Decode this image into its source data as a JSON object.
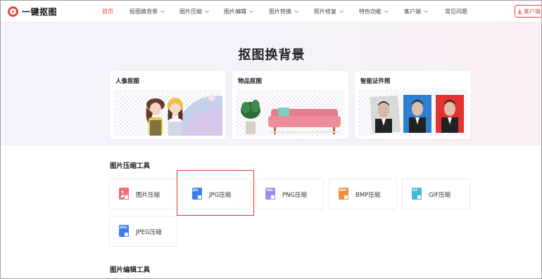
{
  "brand": {
    "name": "一键抠图",
    "color": "#e84a3c"
  },
  "nav": {
    "items": [
      {
        "label": "首页",
        "active": true,
        "dropdown": false
      },
      {
        "label": "抠图换背景",
        "active": false,
        "dropdown": true
      },
      {
        "label": "图片压缩",
        "active": false,
        "dropdown": true
      },
      {
        "label": "图片编辑",
        "active": false,
        "dropdown": true
      },
      {
        "label": "图片转换",
        "active": false,
        "dropdown": true
      },
      {
        "label": "照片修复",
        "active": false,
        "dropdown": true
      },
      {
        "label": "特色功能",
        "active": false,
        "dropdown": true
      },
      {
        "label": "客户端",
        "active": false,
        "dropdown": true
      },
      {
        "label": "常见问题",
        "active": false,
        "dropdown": false
      }
    ],
    "client_button": "客户端"
  },
  "hero": {
    "title": "抠图换背景",
    "categories": [
      {
        "label": "人像抠图",
        "image": "portrait-photo"
      },
      {
        "label": "物品抠图",
        "image": "object-photo"
      },
      {
        "label": "智能证件照",
        "image": "id-photo"
      }
    ]
  },
  "compress_section": {
    "title": "图片压缩工具",
    "tools": [
      {
        "label": "图片压缩",
        "icon": "image-compress-icon",
        "ext": "",
        "color": "#ef6e6e"
      },
      {
        "label": "JPG压缩",
        "icon": "jpg-file-icon",
        "ext": "JPG",
        "color": "#3a7cf5"
      },
      {
        "label": "PNG压缩",
        "icon": "png-file-icon",
        "ext": "PNG",
        "color": "#9c8cf0"
      },
      {
        "label": "BMP压缩",
        "icon": "bmp-file-icon",
        "ext": "BMP",
        "color": "#f58a3a"
      },
      {
        "label": "GIF压缩",
        "icon": "gif-file-icon",
        "ext": "GIF",
        "color": "#3ab9d8"
      },
      {
        "label": "JPEG压缩",
        "icon": "jpeg-file-icon",
        "ext": "JPEG",
        "color": "#3a7cf5"
      }
    ]
  },
  "edit_section": {
    "title": "图片编辑工具"
  }
}
